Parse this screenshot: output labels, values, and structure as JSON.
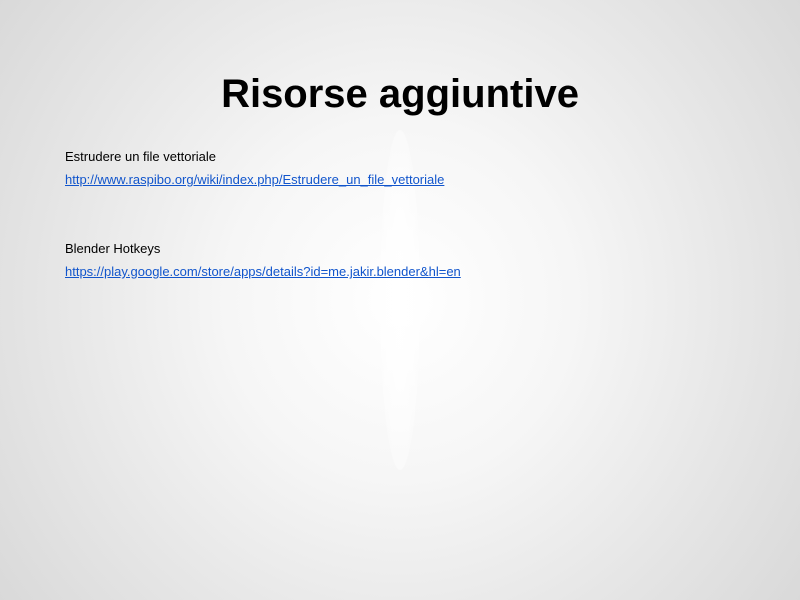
{
  "slide": {
    "title": "Risorse aggiuntive",
    "resources": [
      {
        "label": "Estrudere un file vettoriale",
        "url": "http://www.raspibo.org/wiki/index.php/Estrudere_un_file_vettoriale"
      },
      {
        "label": "Blender Hotkeys",
        "url": "https://play.google.com/store/apps/details?id=me.jakir.blender&hl=en"
      }
    ]
  },
  "colors": {
    "text": "#000000",
    "link": "#1155cc",
    "background_center": "#ffffff",
    "background_edge": "#d9d9d9"
  }
}
